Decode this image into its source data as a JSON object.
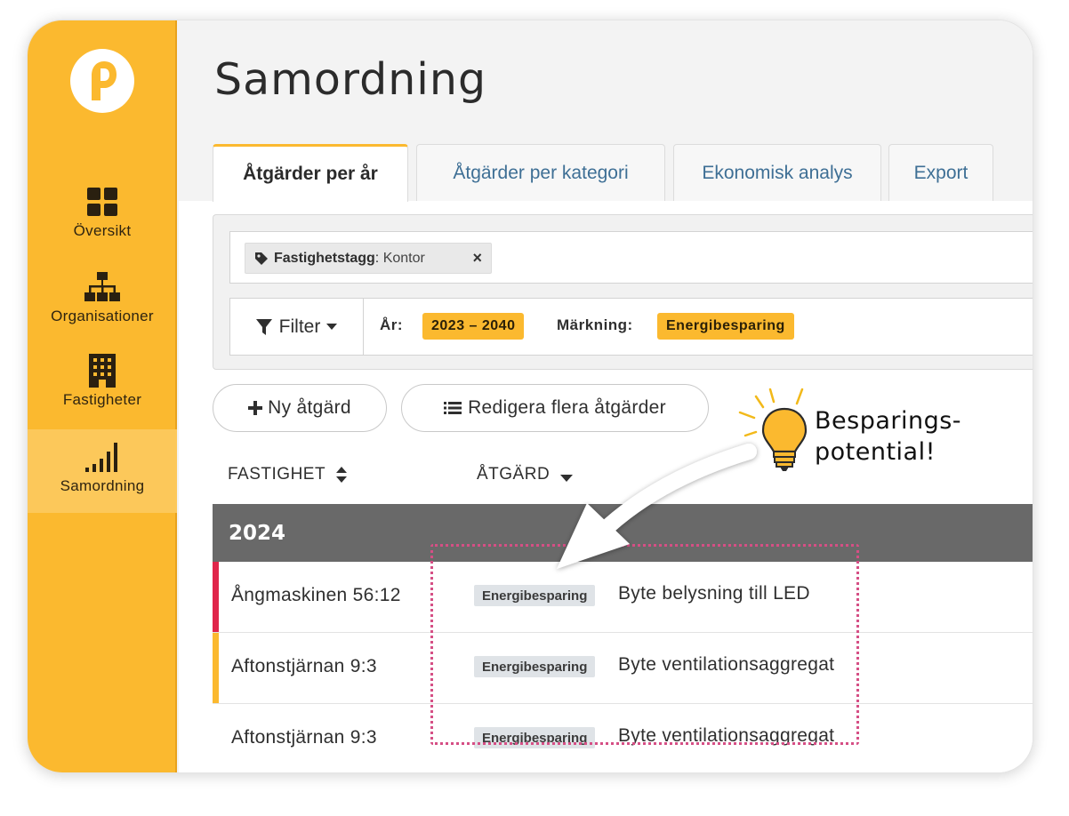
{
  "app": {
    "title": "Samordning",
    "brand_color": "#fbb92f",
    "logo_icon": "parkpilot-logo-icon"
  },
  "sidebar": {
    "items": [
      {
        "label": "Översikt",
        "icon": "grid-icon",
        "active": false
      },
      {
        "label": "Organisationer",
        "icon": "org-chart-icon",
        "active": false
      },
      {
        "label": "Fastigheter",
        "icon": "building-icon",
        "active": false
      },
      {
        "label": "Samordning",
        "icon": "signal-bars-icon",
        "active": true
      }
    ]
  },
  "tabs": [
    {
      "label": "Åtgärder per år",
      "active": true
    },
    {
      "label": "Åtgärder per kategori",
      "active": false
    },
    {
      "label": "Ekonomisk analys",
      "active": false
    },
    {
      "label": "Export",
      "active": false
    }
  ],
  "filters": {
    "tag_chip": {
      "key": "Fastighetstagg",
      "separator": ":",
      "value": " Kontor",
      "remove": "×"
    },
    "filter_button": "Filter",
    "year_label": "År:",
    "year_value": "2023 – 2040",
    "marking_label": "Märkning:",
    "marking_value": "Energibesparing"
  },
  "actions": {
    "new_action": "Ny åtgärd",
    "edit_multiple": "Redigera flera åtgärder"
  },
  "table": {
    "columns": [
      {
        "label": "FASTIGHET",
        "sort_icon": "sort-both-icon"
      },
      {
        "label": "ÅTGÄRD",
        "sort_icon": "caret-down-icon"
      }
    ],
    "groups": [
      {
        "year": "2024",
        "rows": [
          {
            "property": "Ångmaskinen 56:12",
            "badge": "Energibesparing",
            "action": "Byte belysning till LED",
            "edge_color": "#e0254a"
          },
          {
            "property": "Aftonstjärnan 9:3",
            "badge": "Energibesparing",
            "action": "Byte ventilationsaggregat",
            "edge_color": "#fbb92f"
          },
          {
            "property": "Aftonstjärnan 9:3",
            "badge": "Energibesparing",
            "action": "Byte ventilationsaggregat",
            "edge_color": ""
          }
        ]
      }
    ]
  },
  "annotation": {
    "line1": "Besparings-",
    "line2": "potential!",
    "icon": "light-bulb-icon",
    "highlight_color": "#d54f85"
  }
}
